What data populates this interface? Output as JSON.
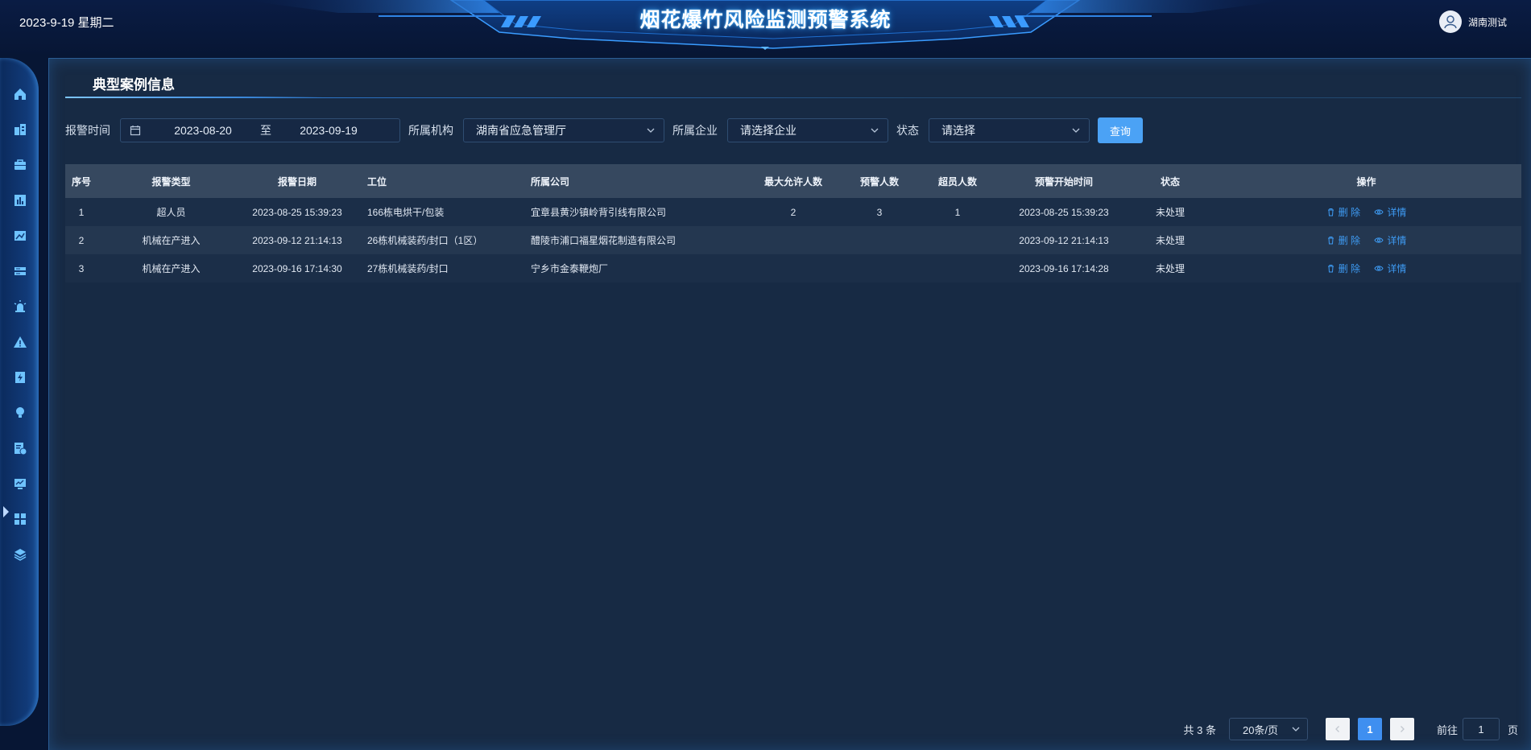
{
  "header": {
    "date": "2023-9-19 星期二",
    "title": "烟花爆竹风险监测预警系统",
    "user": "湖南测试"
  },
  "colors": {
    "accent": "#4ba2f5",
    "panel": "#172a44",
    "nav": "#113a78",
    "link": "#3e9bf3"
  },
  "sidebar": {
    "items": [
      {
        "icon": "home-icon"
      },
      {
        "icon": "building-icon"
      },
      {
        "icon": "briefcase-icon"
      },
      {
        "icon": "bar-chart-icon"
      },
      {
        "icon": "image-chart-icon"
      },
      {
        "icon": "server-icon"
      },
      {
        "icon": "alarm-light-icon"
      },
      {
        "icon": "warning-icon"
      },
      {
        "icon": "power-doc-icon"
      },
      {
        "icon": "bulb-icon"
      },
      {
        "icon": "case-doc-icon"
      },
      {
        "icon": "monitor-icon"
      },
      {
        "icon": "grid-icon"
      },
      {
        "icon": "layers-icon"
      }
    ],
    "active_index": 10
  },
  "page": {
    "title": "典型案例信息"
  },
  "filters": {
    "time_label": "报警时间",
    "start_date": "2023-08-20",
    "range_sep": "至",
    "end_date": "2023-09-19",
    "org_label": "所属机构",
    "org_value": "湖南省应急管理厅",
    "ent_label": "所属企业",
    "ent_placeholder": "请选择企业",
    "status_label": "状态",
    "status_placeholder": "请选择",
    "query_label": "查询"
  },
  "table": {
    "headers": [
      "序号",
      "报警类型",
      "报警日期",
      "工位",
      "所属公司",
      "最大允许人数",
      "预警人数",
      "超员人数",
      "预警开始时间",
      "状态",
      "操作"
    ],
    "rows": [
      {
        "no": "1",
        "type": "超人员",
        "date": "2023-08-25 15:39:23",
        "station": "166栋电烘干/包装",
        "company": "宜章县黄沙镇岭背引线有限公司",
        "max": "2",
        "warn": "3",
        "over": "1",
        "start": "2023-08-25 15:39:23",
        "status": "未处理"
      },
      {
        "no": "2",
        "type": "机械在产进入",
        "date": "2023-09-12 21:14:13",
        "station": "26栋机械装药/封口（1区）",
        "company": "醴陵市浦口福星烟花制造有限公司",
        "max": "",
        "warn": "",
        "over": "",
        "start": "2023-09-12 21:14:13",
        "status": "未处理"
      },
      {
        "no": "3",
        "type": "机械在产进入",
        "date": "2023-09-16 17:14:30",
        "station": "27栋机械装药/封口",
        "company": "宁乡市金泰鞭炮厂",
        "max": "",
        "warn": "",
        "over": "",
        "start": "2023-09-16 17:14:28",
        "status": "未处理"
      }
    ],
    "ops": {
      "delete": "删 除",
      "detail": "详情"
    }
  },
  "pagination": {
    "total": "共 3 条",
    "page_size": "20条/页",
    "current": "1",
    "goto_label": "前往",
    "goto_value": "1",
    "page_suffix": "页"
  }
}
